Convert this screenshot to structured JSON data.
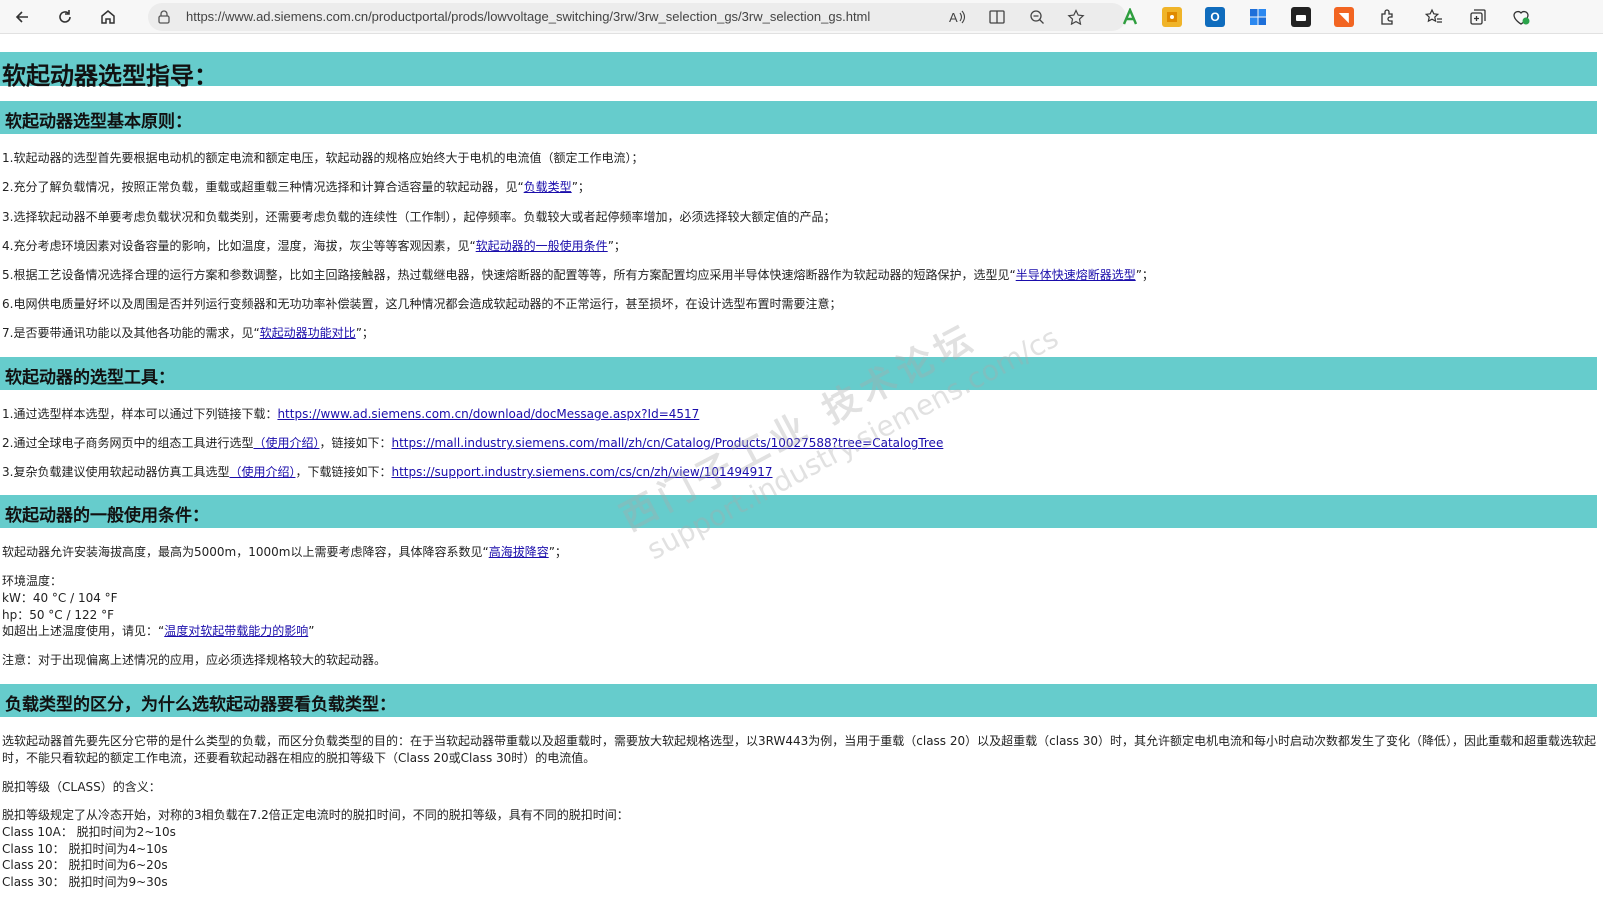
{
  "browser": {
    "url": "https://www.ad.siemens.com.cn/productportal/prods/lowvoltage_switching/3rw/3rw_selection_gs/3rw_selection_gs.html",
    "ext_labels": {
      "outlook": "O",
      "rss": "◥"
    }
  },
  "page": {
    "title": "软起动器选型指导：",
    "sections": {
      "principles": {
        "heading": "软起动器选型基本原则：",
        "items": [
          {
            "pre": "1.软起动器的选型首先要根据电动机的额定电流和额定电压，软起动器的规格应始终大于电机的电流值（额定工作电流）；",
            "link": "",
            "post": ""
          },
          {
            "pre": "2.充分了解负载情况，按照正常负载，重载或超重载三种情况选择和计算合适容量的软起动器，见“",
            "link": "负载类型",
            "post": "”；"
          },
          {
            "pre": "3.选择软起动器不单要考虑负载状况和负载类别，还需要考虑负载的连续性（工作制），起停频率。负载较大或者起停频率增加，必须选择较大额定值的产品；",
            "link": "",
            "post": ""
          },
          {
            "pre": "4.充分考虑环境因素对设备容量的影响，比如温度，湿度，海拔，灰尘等等客观因素，见“",
            "link": "软起动器的一般使用条件",
            "post": "”；"
          },
          {
            "pre": "5.根据工艺设备情况选择合理的运行方案和参数调整，比如主回路接触器，热过载继电器，快速熔断器的配置等等，所有方案配置均应采用半导体快速熔断器作为软起动器的短路保护，选型见“",
            "link": "半导体快速熔断器选型",
            "post": "”；"
          },
          {
            "pre": "6.电网供电质量好坏以及周围是否并列运行变频器和无功功率补偿装置，这几种情况都会造成软起动器的不正常运行，甚至损坏，在设计选型布置时需要注意；",
            "link": "",
            "post": ""
          },
          {
            "pre": "7.是否要带通讯功能以及其他各功能的需求，见“",
            "link": "软起动器功能对比",
            "post": "”；"
          }
        ]
      },
      "tools": {
        "heading": "软起动器的选型工具：",
        "items": [
          {
            "pre": "1.通过选型样本选型，样本可以通过下列链接下载：",
            "intro": "",
            "mid": "",
            "url": "https://www.ad.siemens.com.cn/download/docMessage.aspx?Id=4517"
          },
          {
            "pre": "2.通过全球电子商务网页中的组态工具进行选型",
            "intro": "（使用介绍）",
            "mid": "，链接如下：",
            "url": "https://mall.industry.siemens.com/mall/zh/cn/Catalog/Products/10027588?tree=CatalogTree"
          },
          {
            "pre": "3.复杂负载建议使用软起动器仿真工具选型",
            "intro": "（使用介绍）",
            "mid": "，下载链接如下：",
            "url": "https://support.industry.siemens.com/cs/cn/zh/view/101494917"
          }
        ]
      },
      "conditions": {
        "heading": "软起动器的一般使用条件：",
        "altitude_pre": "软起动器允许安装海拔高度，最高为5000m，1000m以上需要考虑降容，具体降容系数见“",
        "altitude_link": "高海拔降容",
        "altitude_post": "”；",
        "temp_label": "环境温度：",
        "temp_kw": "kW：40 °C / 104 °F",
        "temp_hp": "hp：50 °C / 122 °F",
        "exceed_pre": "如超出上述温度使用，请见：“",
        "exceed_link": "温度对软起带载能力的影响",
        "exceed_post": "”",
        "note": "注意：对于出现偏离上述情况的应用，应必须选择规格较大的软起动器。"
      },
      "load_types": {
        "heading": "负载类型的区分，为什么选软起动器要看负载类型：",
        "paragraph": "选软起动器首先要先区分它带的是什么类型的负载，而区分负载类型的目的：在于当软起动器带重载以及超重载时，需要放大软起规格选型，以3RW443为例，当用于重载（class 20）以及超重载（class 30）时，其允许额定电机电流和每小时启动次数都发生了变化（降低），因此重载和超重载选软起时，不能只看软起的额定工作电流，还要看软起动器在相应的脱扣等级下（Class 20或Class 30时）的电流值。",
        "class_meaning": "脱扣等级（CLASS）的含义：",
        "class_desc": "脱扣等级规定了从冷态开始，对称的3相负载在7.2倍正定电流时的脱扣时间，不同的脱扣等级，具有不同的脱扣时间：",
        "classes": [
          "Class 10A： 脱扣时间为2~10s",
          "Class 10： 脱扣时间为4~10s",
          "Class 20： 脱扣时间为6~20s",
          "Class 30： 脱扣时间为9~30s"
        ]
      }
    },
    "watermark": {
      "line1": "西门子工业 技术论坛",
      "line2": "support.industry.siemens.com/cs"
    }
  }
}
